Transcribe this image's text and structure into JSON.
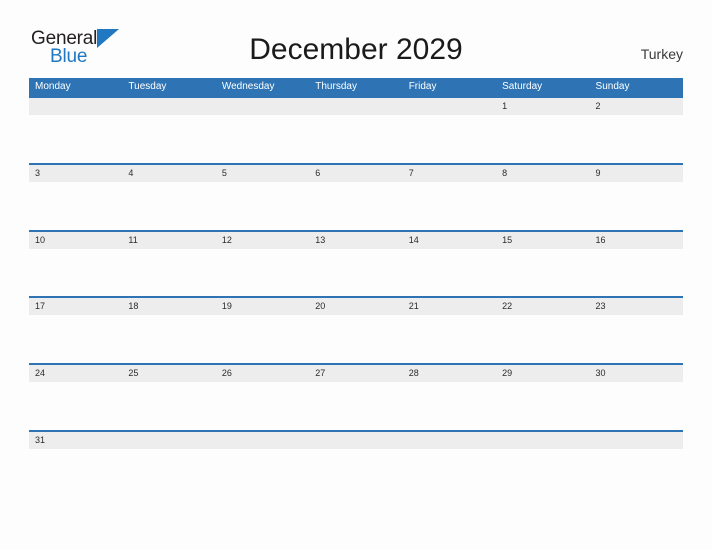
{
  "branding": {
    "logo_primary": "General",
    "logo_secondary": "Blue",
    "flag_icon": "triangle-flag-icon",
    "primary_color": "#231f20",
    "secondary_color": "#1f78c1"
  },
  "header": {
    "title": "December 2029",
    "region": "Turkey"
  },
  "theme": {
    "header_blue": "#2e74b5",
    "date_band_gray": "#ededed",
    "page_background": "#fdfdfd",
    "separator_blue": "#2e74b5"
  },
  "calendar": {
    "month": "December",
    "year": "2029",
    "week_start": "Monday",
    "weekdays": [
      "Monday",
      "Tuesday",
      "Wednesday",
      "Thursday",
      "Friday",
      "Saturday",
      "Sunday"
    ],
    "weeks": [
      [
        "",
        "",
        "",
        "",
        "",
        "1",
        "2"
      ],
      [
        "3",
        "4",
        "5",
        "6",
        "7",
        "8",
        "9"
      ],
      [
        "10",
        "11",
        "12",
        "13",
        "14",
        "15",
        "16"
      ],
      [
        "17",
        "18",
        "19",
        "20",
        "21",
        "22",
        "23"
      ],
      [
        "24",
        "25",
        "26",
        "27",
        "28",
        "29",
        "30"
      ],
      [
        "31",
        "",
        "",
        "",
        "",
        "",
        ""
      ]
    ]
  }
}
